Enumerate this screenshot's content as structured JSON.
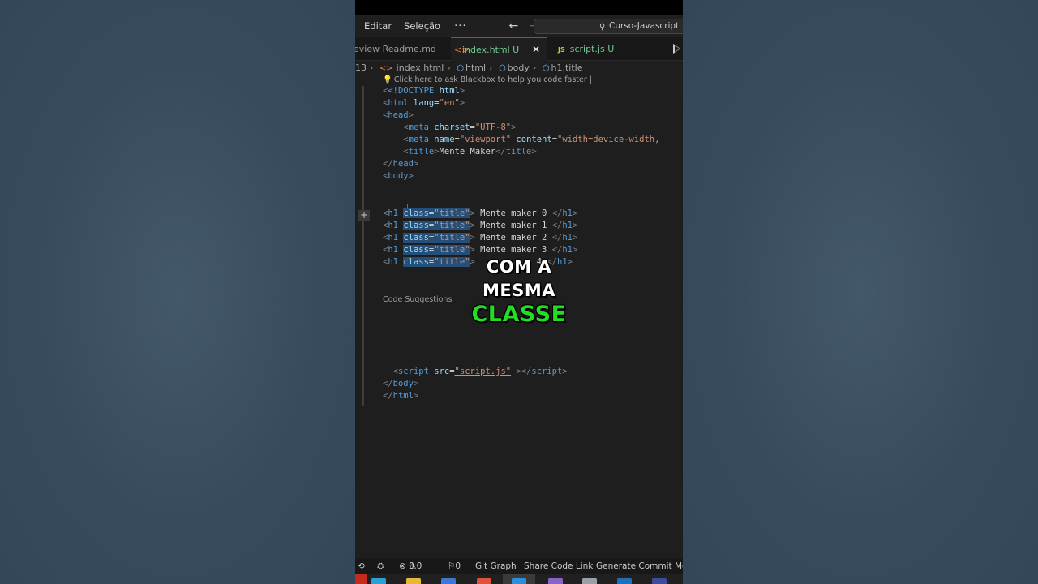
{
  "menubar": {
    "edit": "Editar",
    "selection": "Seleção",
    "more": "···",
    "search": "Curso-Javascript"
  },
  "tabs": [
    {
      "label": "eview Readme.md"
    },
    {
      "label": "index.html",
      "status": "U"
    },
    {
      "label": "script.js",
      "status": "U",
      "badge": "JS"
    }
  ],
  "breadcrumb": {
    "prefix": "13",
    "file": "index.html",
    "html": "html",
    "body": "body",
    "element": "h1.title"
  },
  "hint": "Click here to ask Blackbox to help you code faster |",
  "code": {
    "doctype": "<!DOCTYPE",
    "doctype_html": "html",
    "title_text": "Mente Maker",
    "charset": "\"UTF-8\"",
    "viewport": "\"viewport\"",
    "viewport_content": "\"width=device-width,",
    "h1_class": "\"title\"",
    "h1_items": [
      "Mente maker 0",
      "Mente maker 1",
      "Mente maker 2",
      "Mente maker 3",
      "4"
    ],
    "script_src": "\"script.js\""
  },
  "code_suggestions": "Code Suggestions",
  "caption": {
    "line1": "COM A",
    "line2": "MESMA",
    "line3": "CLASSE"
  },
  "statusbar": {
    "errors": "0",
    "warnings": "0",
    "ports": "0",
    "git_graph": "Git Graph",
    "share": "Share Code Link",
    "commit": "Generate Commit Mes"
  },
  "colors": {
    "accent": "#0078d4",
    "caption_highlight": "#22dd22",
    "modified": "#73c991"
  }
}
